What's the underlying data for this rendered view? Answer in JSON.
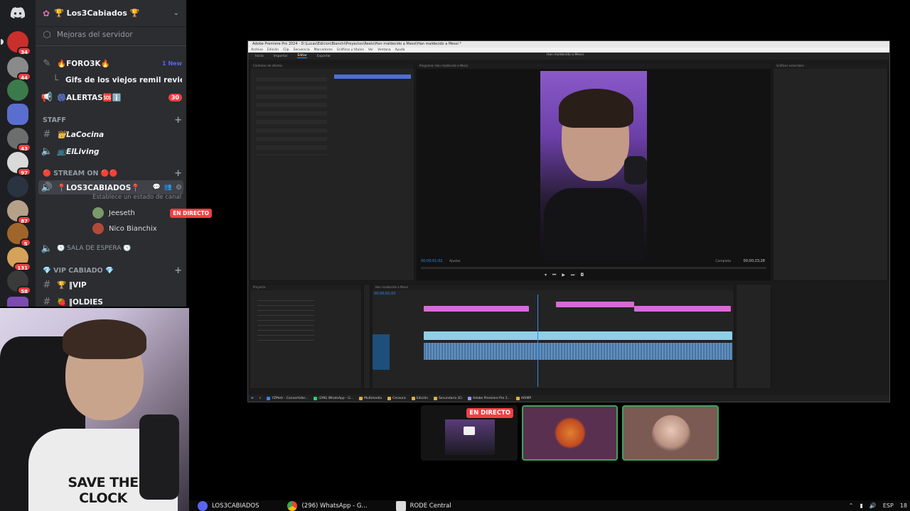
{
  "discord": {
    "server_name": "🏆 Los3Cabiados 🏆",
    "boost_label": "Mejoras del servidor",
    "channels": {
      "foro": {
        "label": "🔥FORO3K🔥",
        "badge": "1 New"
      },
      "gifs": {
        "label": "Gifs de los viejos remil reviejos"
      },
      "alertas": {
        "label": "🎆ALERTAS🆘ℹ️",
        "badge": "30"
      },
      "staff_category": "STAFF",
      "lacocina": {
        "label": "👑LaCocina"
      },
      "elliving": {
        "label": "📺ElLiving"
      },
      "stream_category": "🔴 STREAM ON 🔴🔴",
      "voice_channel": {
        "label": "📍LOS3CABIADOS📍",
        "status_hint": "Establece un estado de canal"
      },
      "sala_espera": {
        "label": "🕓 SALA DE ESPERA 🕓"
      },
      "vip_category": "💎 VIP CABIADO 💎",
      "vip": {
        "label": "🏆 ‖VIP"
      },
      "oldies": {
        "label": "🍓 ‖OLDIES"
      }
    },
    "voice_users": [
      {
        "name": "Jeeseth",
        "live": "EN DIRECTO"
      },
      {
        "name": "Nico Bianchix"
      }
    ],
    "server_badges": [
      "34",
      "44",
      "43",
      "97",
      "87",
      "5",
      "131",
      "58"
    ]
  },
  "webcam": {
    "shirt_text": "SAVE THE CLOCK"
  },
  "premiere": {
    "title": "Adobe Premiere Pro 2024 - D:\\Lucas\\Edicion\\Bianchi\\Proyectos\\Reels\\Han malde​cido a Messi\\Han maldecido a Messi *",
    "menu": [
      "Archivo",
      "Edición",
      "Clip",
      "Secuencia",
      "Marcadores",
      "Gráficos y títulos",
      "Ver",
      "Ventana",
      "Ayuda"
    ],
    "workspaces": [
      "Inicio",
      "Importar",
      "Editar",
      "Exportar"
    ],
    "program_title": "Han maldecido a Messi",
    "effect_tab": "Controles de efectos",
    "program_tab": "Programa: Han maldecido a Messi",
    "timecode": "00;00;01;02",
    "timecode_end": "00;00;23;28",
    "fit_label": "Ajustar",
    "quality_label": "Completa",
    "effects_panel": "Gráficos esenciales",
    "project_tab": "Proyecto",
    "timeline_tab": "Han maldecido a Messi",
    "taskbar_items": [
      "YZMetr - Convertidor...",
      "(296) WhatsApp - G...",
      "Multimedia",
      "Censura",
      "Edición",
      "Secundario (E)",
      "Adobe Premiere Pro 2...",
      "ARIMP"
    ]
  },
  "tiles": [
    {
      "label": "EN DIRECTO"
    }
  ],
  "taskbar": {
    "apps": [
      "LOS3CABIADOS",
      "(296) WhatsApp - G...",
      "RODE Central"
    ],
    "lang": "ESP",
    "clock": "18"
  }
}
